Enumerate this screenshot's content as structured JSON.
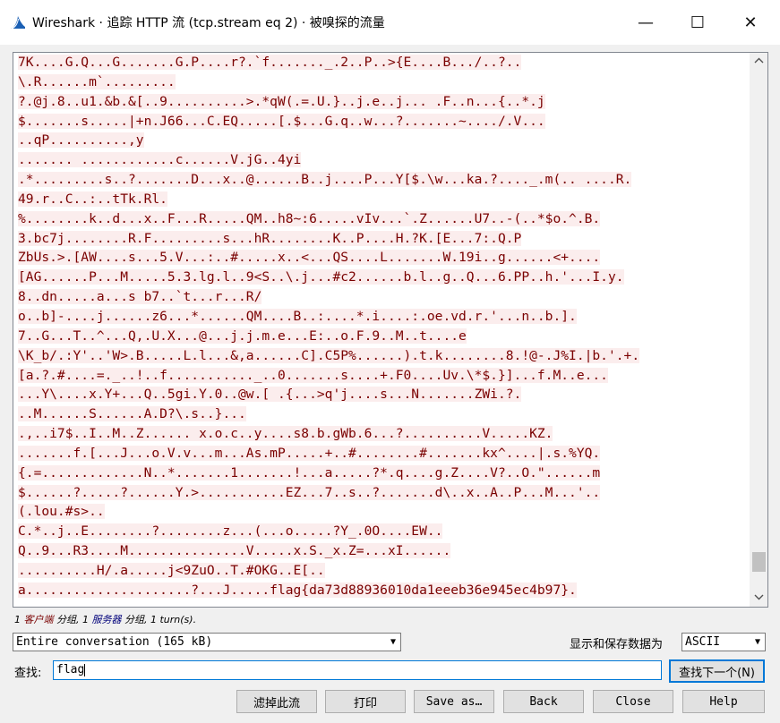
{
  "window": {
    "title": "Wireshark · 追踪 HTTP 流 (tcp.stream eq 2) · 被嗅探的流量",
    "minimize_glyph": "—",
    "maximize_glyph": "☐",
    "close_glyph": "✕",
    "app_icon": "wireshark-fin-icon",
    "accent_color": "#1a5fb4"
  },
  "stream": {
    "client_text_color": "#7a0000",
    "client_bg_color": "#fbeded",
    "lines": [
      "7K....G.Q...G.......G.P....r?.`f......._.2..P..>{E....B.../..?..",
      "\\.R......m`.........",
      "?.@j.8..u1.&b.&[..9..........>.*qW(.=.U.}..j.e..j... .F..n...{..*.j",
      "$.......s.....|+n.J66...C.EQ.....[.$...G.q..w...?.......~..../.V...",
      "..qP..........,y",
      "....... ............c......V.jG..4yi",
      ".*.........s..?.......D...x..@......B..j....P...Y[$.\\w...ka.?...._.m(.. ....R.",
      "49.r..C..:..tTk.Rl.",
      "%........k..d...x..F...R.....QM..h8~:6.....vIv...`.Z......U7..-(..*$o.^.B.",
      "3.bc7j........R.F.........s...hR........K..P....H.?K.[E...7:.Q.P",
      "ZbUs.>.[AW....s...5.V...:..#.....x..<...QS....L.......W.19i..g......<+....",
      "[AG......P...M.....5.3.lg.l..9<S..\\.j...#c2......b.l..g..Q...6.PP..h.'...I.y.",
      "8..dn.....a...s b7..`t...r...R/",
      "o..b]-....j......z6...*......QM....B..:....*.i....:.oe.vd.r.'...n..b.].",
      "7..G...T..^...Q,.U.X...@...j.j.m.e...E:..o.F.9..M..t....e",
      "\\K_b/.:Y'..'W>.B.....L.l...&,a......C].C5P%......).t.k........8.!@-.J%I.|b.'.+.",
      "[a.?.#....=._..!..f..........._..0.......s....+.F0....Uv.\\*$.}]...f.M..e...",
      "...Y\\....x.Y+...Q..5gi.Y.0..@w.[ .{...>q'j....s...N.......ZWi.?.",
      "..M......S......A.D?\\.s..}...",
      ".,..i7$..I..M..Z...... x.o.c..y....s8.b.gWb.6...?..........V.....KZ.",
      ".......f.[...J...o.V.v...m...As.mP.....+..#........#.......kx^....|.s.%YQ.",
      "{.=.............N..*.......1.......!...a.....?*.q....g.Z....V?..O.\"......m",
      "$......?.....?......Y.>...........EZ...7..s..?.......d\\..x..A..P...M...'..",
      "(.lou.#s>..",
      "C.*..j..E........?........z...(...o.....?Y_.0O....EW..",
      "Q..9...R3....M...............V.....x.S._x.Z=...xI......",
      "..........H/.a.....j<9ZuO..T.#OKG..E[..",
      "a.....................?...J.....flag{da73d88936010da1eeeb36e945ec4b97}."
    ]
  },
  "summary": {
    "prefix": "1 ",
    "client_label": "客户端",
    "client_suffix": " 分组, 1 ",
    "server_label": "服务器",
    "server_suffix": " 分组, 1 turn(s)."
  },
  "conversation_select": {
    "value": "Entire conversation (165 kB)"
  },
  "display_as": {
    "label": "显示和保存数据为",
    "value": "ASCII"
  },
  "find": {
    "label": "查找:",
    "value": "flag",
    "next_button": "查找下一个(N)"
  },
  "buttons": {
    "filter_out": "滤掉此流",
    "print": "打印",
    "save_as": "Save as…",
    "back": "Back",
    "close": "Close",
    "help": "Help"
  },
  "scrollbar": {
    "up_glyph": "︿",
    "down_glyph": "﹀",
    "position": 0.95
  }
}
